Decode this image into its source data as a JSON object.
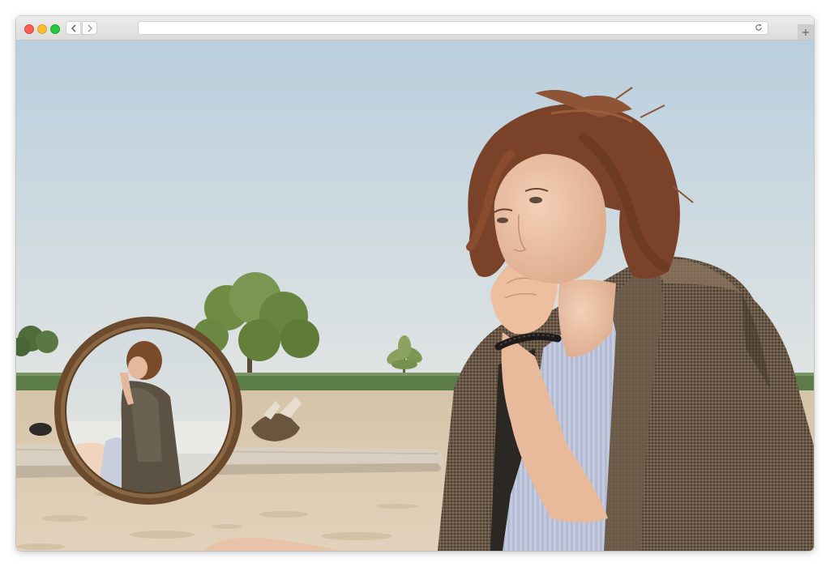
{
  "browser": {
    "url": "",
    "controls": [
      "close",
      "minimize",
      "zoom"
    ],
    "nav_icons": [
      "chevron-left-icon",
      "chevron-right-icon"
    ],
    "reload_icon": "reload-icon",
    "newtab_icon": "plus-icon"
  },
  "photo": {
    "description_icon": "photo",
    "colors": {
      "sky_top": "#b9cfde",
      "sky_bottom": "#dfe3e3",
      "grass": "#5b7b49",
      "sand": "#d9c7ad",
      "jacket": "#5e4d3e",
      "hair": "#7a4228",
      "mirror_frame": "#6b4a2e"
    }
  }
}
